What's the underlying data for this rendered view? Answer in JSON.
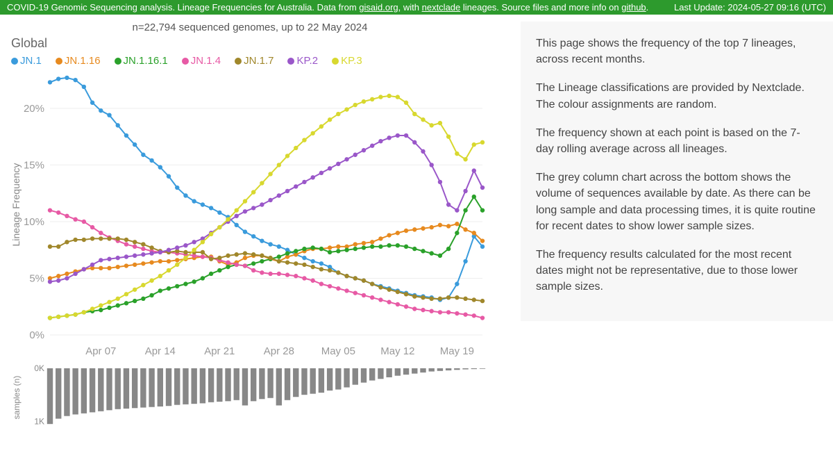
{
  "header": {
    "prefix": "COVID-19 Genomic Sequencing analysis. Lineage Frequencies for Australia. Data from ",
    "link1_text": "gisaid.org",
    "mid1": ", with ",
    "link2_text": "nextclade",
    "mid2": " lineages. Source files and more info on ",
    "link3_text": "github",
    "suffix": ".",
    "last_update": "Last Update: 2024-05-27 09:16 (UTC)"
  },
  "chart_meta": {
    "subtitle": "n=22,794 sequenced genomes, up to 22 May 2024",
    "title": "Global",
    "y_axis_label": "Lineage Frequency",
    "samples_axis_label": "samples (n)"
  },
  "side_paragraphs": [
    "This page shows the frequency of the top 7 lineages, across recent months.",
    "The Lineage classifications are provided by Nextclade. The colour assignments are random.",
    "The frequency shown at each point is based on the 7-day rolling average across all lineages.",
    "The grey column chart across the bottom shows the volume of sequences available by date.  As there can be long sample and data processing times, it is quite routine for recent dates to show lower sample sizes.",
    "The frequency results calculated for the most recent dates might not be representative, due to those lower sample sizes."
  ],
  "chart_data": {
    "type": "line",
    "title": "Global",
    "ylabel": "Lineage Frequency",
    "ylim": [
      0,
      23
    ],
    "y_ticks": [
      0,
      5,
      10,
      15,
      20
    ],
    "y_tick_labels": [
      "0%",
      "5%",
      "10%",
      "15%",
      "20%"
    ],
    "x_tick_labels": [
      "Apr 07",
      "Apr 14",
      "Apr 21",
      "Apr 28",
      "May 05",
      "May 12",
      "May 19"
    ],
    "x_tick_idx": [
      6,
      13,
      20,
      27,
      34,
      41,
      48
    ],
    "colors": {
      "JN.1": "#3a9bdc",
      "JN.1.16": "#e78a1f",
      "JN.1.16.1": "#2aa12a",
      "JN.1.4": "#e75aa5",
      "JN.1.7": "#a0872b",
      "KP.2": "#9a57c9",
      "KP.3": "#d8d82f"
    },
    "series": [
      {
        "name": "JN.1",
        "values": [
          22.3,
          22.6,
          22.7,
          22.5,
          21.9,
          20.5,
          19.8,
          19.4,
          18.5,
          17.6,
          16.8,
          15.9,
          15.4,
          14.8,
          14.0,
          13.0,
          12.3,
          11.8,
          11.5,
          11.2,
          10.8,
          10.4,
          9.7,
          9.1,
          8.7,
          8.3,
          8.0,
          7.8,
          7.5,
          7.1,
          6.8,
          6.5,
          6.3,
          6.0,
          5.5,
          5.2,
          5.0,
          4.8,
          4.5,
          4.3,
          4.1,
          3.9,
          3.7,
          3.5,
          3.4,
          3.3,
          3.1,
          3.3,
          4.5,
          6.5,
          8.7,
          7.8
        ]
      },
      {
        "name": "JN.1.16",
        "values": [
          5.0,
          5.2,
          5.4,
          5.6,
          5.8,
          5.9,
          5.9,
          5.9,
          6.0,
          6.1,
          6.2,
          6.3,
          6.4,
          6.5,
          6.5,
          6.6,
          6.7,
          6.8,
          6.9,
          6.9,
          6.5,
          6.2,
          6.4,
          6.8,
          7.0,
          7.0,
          6.7,
          6.5,
          6.9,
          7.1,
          7.4,
          7.6,
          7.6,
          7.7,
          7.8,
          7.8,
          8.0,
          8.1,
          8.2,
          8.5,
          8.8,
          9.0,
          9.2,
          9.3,
          9.4,
          9.5,
          9.7,
          9.6,
          9.8,
          9.3,
          9.0,
          8.3
        ]
      },
      {
        "name": "JN.1.16.1",
        "values": [
          1.5,
          1.6,
          1.7,
          1.8,
          2.0,
          2.1,
          2.2,
          2.4,
          2.6,
          2.8,
          3.0,
          3.2,
          3.5,
          3.9,
          4.1,
          4.3,
          4.5,
          4.7,
          5.0,
          5.4,
          5.7,
          6.0,
          6.2,
          6.1,
          6.3,
          6.5,
          6.7,
          6.9,
          7.2,
          7.4,
          7.6,
          7.7,
          7.6,
          7.3,
          7.4,
          7.5,
          7.6,
          7.7,
          7.8,
          7.8,
          7.9,
          7.9,
          7.8,
          7.6,
          7.4,
          7.2,
          7.0,
          7.6,
          9.0,
          11.0,
          12.2,
          11.0
        ]
      },
      {
        "name": "JN.1.4",
        "values": [
          11.0,
          10.8,
          10.5,
          10.2,
          10.0,
          9.5,
          9.0,
          8.6,
          8.3,
          8.0,
          7.8,
          7.6,
          7.4,
          7.3,
          7.3,
          7.2,
          7.1,
          7.0,
          6.9,
          6.8,
          6.6,
          6.4,
          6.2,
          6.1,
          5.7,
          5.5,
          5.4,
          5.4,
          5.3,
          5.2,
          5.0,
          4.8,
          4.5,
          4.3,
          4.1,
          3.9,
          3.7,
          3.5,
          3.3,
          3.1,
          2.9,
          2.7,
          2.5,
          2.3,
          2.2,
          2.1,
          2.0,
          2.0,
          1.9,
          1.8,
          1.7,
          1.5
        ]
      },
      {
        "name": "JN.1.7",
        "values": [
          7.8,
          7.8,
          8.2,
          8.4,
          8.4,
          8.5,
          8.5,
          8.5,
          8.5,
          8.4,
          8.2,
          8.0,
          7.7,
          7.4,
          7.3,
          7.4,
          7.3,
          7.3,
          7.3,
          6.7,
          6.8,
          7.0,
          7.1,
          7.2,
          7.1,
          7.0,
          6.8,
          6.5,
          6.4,
          6.3,
          6.2,
          6.0,
          5.8,
          5.7,
          5.5,
          5.2,
          5.0,
          4.8,
          4.5,
          4.2,
          4.0,
          3.8,
          3.6,
          3.4,
          3.3,
          3.2,
          3.2,
          3.3,
          3.3,
          3.2,
          3.1,
          3.0
        ]
      },
      {
        "name": "KP.2",
        "values": [
          4.7,
          4.8,
          5.0,
          5.4,
          5.8,
          6.2,
          6.6,
          6.7,
          6.8,
          6.9,
          7.0,
          7.1,
          7.2,
          7.3,
          7.5,
          7.7,
          7.9,
          8.2,
          8.5,
          9.0,
          9.5,
          10.0,
          10.5,
          10.9,
          11.2,
          11.5,
          11.9,
          12.3,
          12.7,
          13.1,
          13.5,
          13.9,
          14.3,
          14.7,
          15.1,
          15.5,
          15.9,
          16.3,
          16.7,
          17.1,
          17.4,
          17.6,
          17.6,
          17.0,
          16.2,
          15.0,
          13.5,
          11.5,
          11.0,
          12.7,
          14.5,
          13.0
        ]
      },
      {
        "name": "KP.3",
        "values": [
          1.5,
          1.6,
          1.7,
          1.8,
          2.0,
          2.3,
          2.6,
          2.9,
          3.2,
          3.6,
          4.0,
          4.4,
          4.8,
          5.2,
          5.7,
          6.2,
          6.8,
          7.5,
          8.2,
          8.9,
          9.5,
          10.2,
          11.0,
          11.8,
          12.6,
          13.4,
          14.2,
          15.0,
          15.8,
          16.5,
          17.2,
          17.8,
          18.4,
          19.0,
          19.5,
          19.9,
          20.3,
          20.6,
          20.8,
          21.0,
          21.1,
          21.0,
          20.5,
          19.5,
          19.0,
          18.5,
          18.7,
          17.5,
          16.0,
          15.5,
          16.8,
          17.0
        ]
      }
    ],
    "samples": {
      "ticks": [
        0,
        1000
      ],
      "tick_labels": [
        "0K",
        "1K"
      ],
      "values": [
        1050,
        950,
        900,
        870,
        850,
        830,
        810,
        790,
        770,
        760,
        750,
        740,
        730,
        720,
        710,
        690,
        680,
        670,
        660,
        640,
        630,
        620,
        600,
        700,
        620,
        580,
        560,
        700,
        600,
        540,
        500,
        480,
        460,
        420,
        400,
        360,
        310,
        270,
        230,
        200,
        170,
        140,
        120,
        100,
        80,
        60,
        50,
        40,
        30,
        20,
        15,
        10
      ]
    }
  }
}
